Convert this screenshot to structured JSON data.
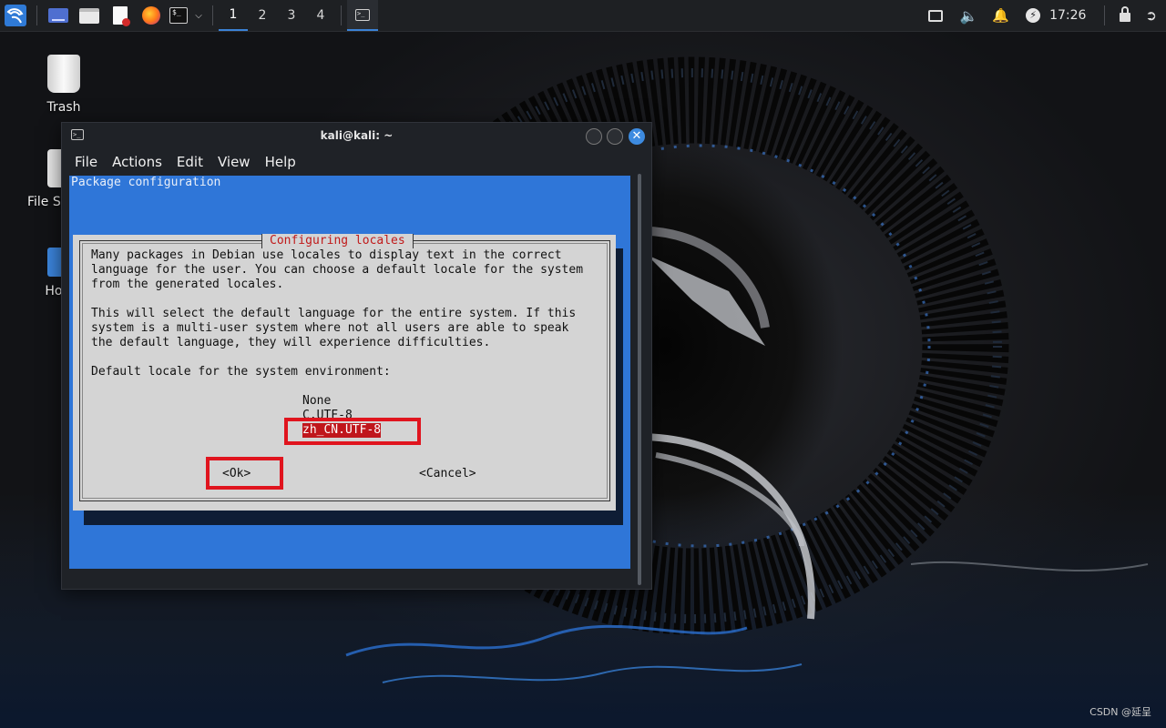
{
  "panel": {
    "workspaces": [
      "1",
      "2",
      "3",
      "4"
    ],
    "active_workspace": "1",
    "clock": "17:26"
  },
  "desktop": {
    "trash_label": "Trash",
    "filesystem_label": "File System",
    "home_label": "Home"
  },
  "window": {
    "title": "kali@kali: ~",
    "menu": [
      "File",
      "Actions",
      "Edit",
      "View",
      "Help"
    ]
  },
  "terminal": {
    "header": "Package configuration",
    "dialog_title": "Configuring locales",
    "description_lines": [
      "Many packages in Debian use locales to display text in the correct",
      "language for the user. You can choose a default locale for the system",
      "from the generated locales.",
      "",
      "This will select the default language for the entire system. If this",
      "system is a multi-user system where not all users are able to speak",
      "the default language, they will experience difficulties.",
      "",
      "Default locale for the system environment:"
    ],
    "options": [
      "None",
      "C.UTF-8",
      "zh_CN.UTF-8"
    ],
    "selected_option": "zh_CN.UTF-8",
    "ok_label": "<Ok>",
    "cancel_label": "<Cancel>"
  },
  "colors": {
    "tty_background": "#2f76d8",
    "dialog_background": "#d4d4d4",
    "dialog_title": "#c01a1a",
    "selection": "#c0161c",
    "highlight_box": "#e0141e",
    "panel_accent": "#3b82d6"
  },
  "watermark": "CSDN @延呈"
}
